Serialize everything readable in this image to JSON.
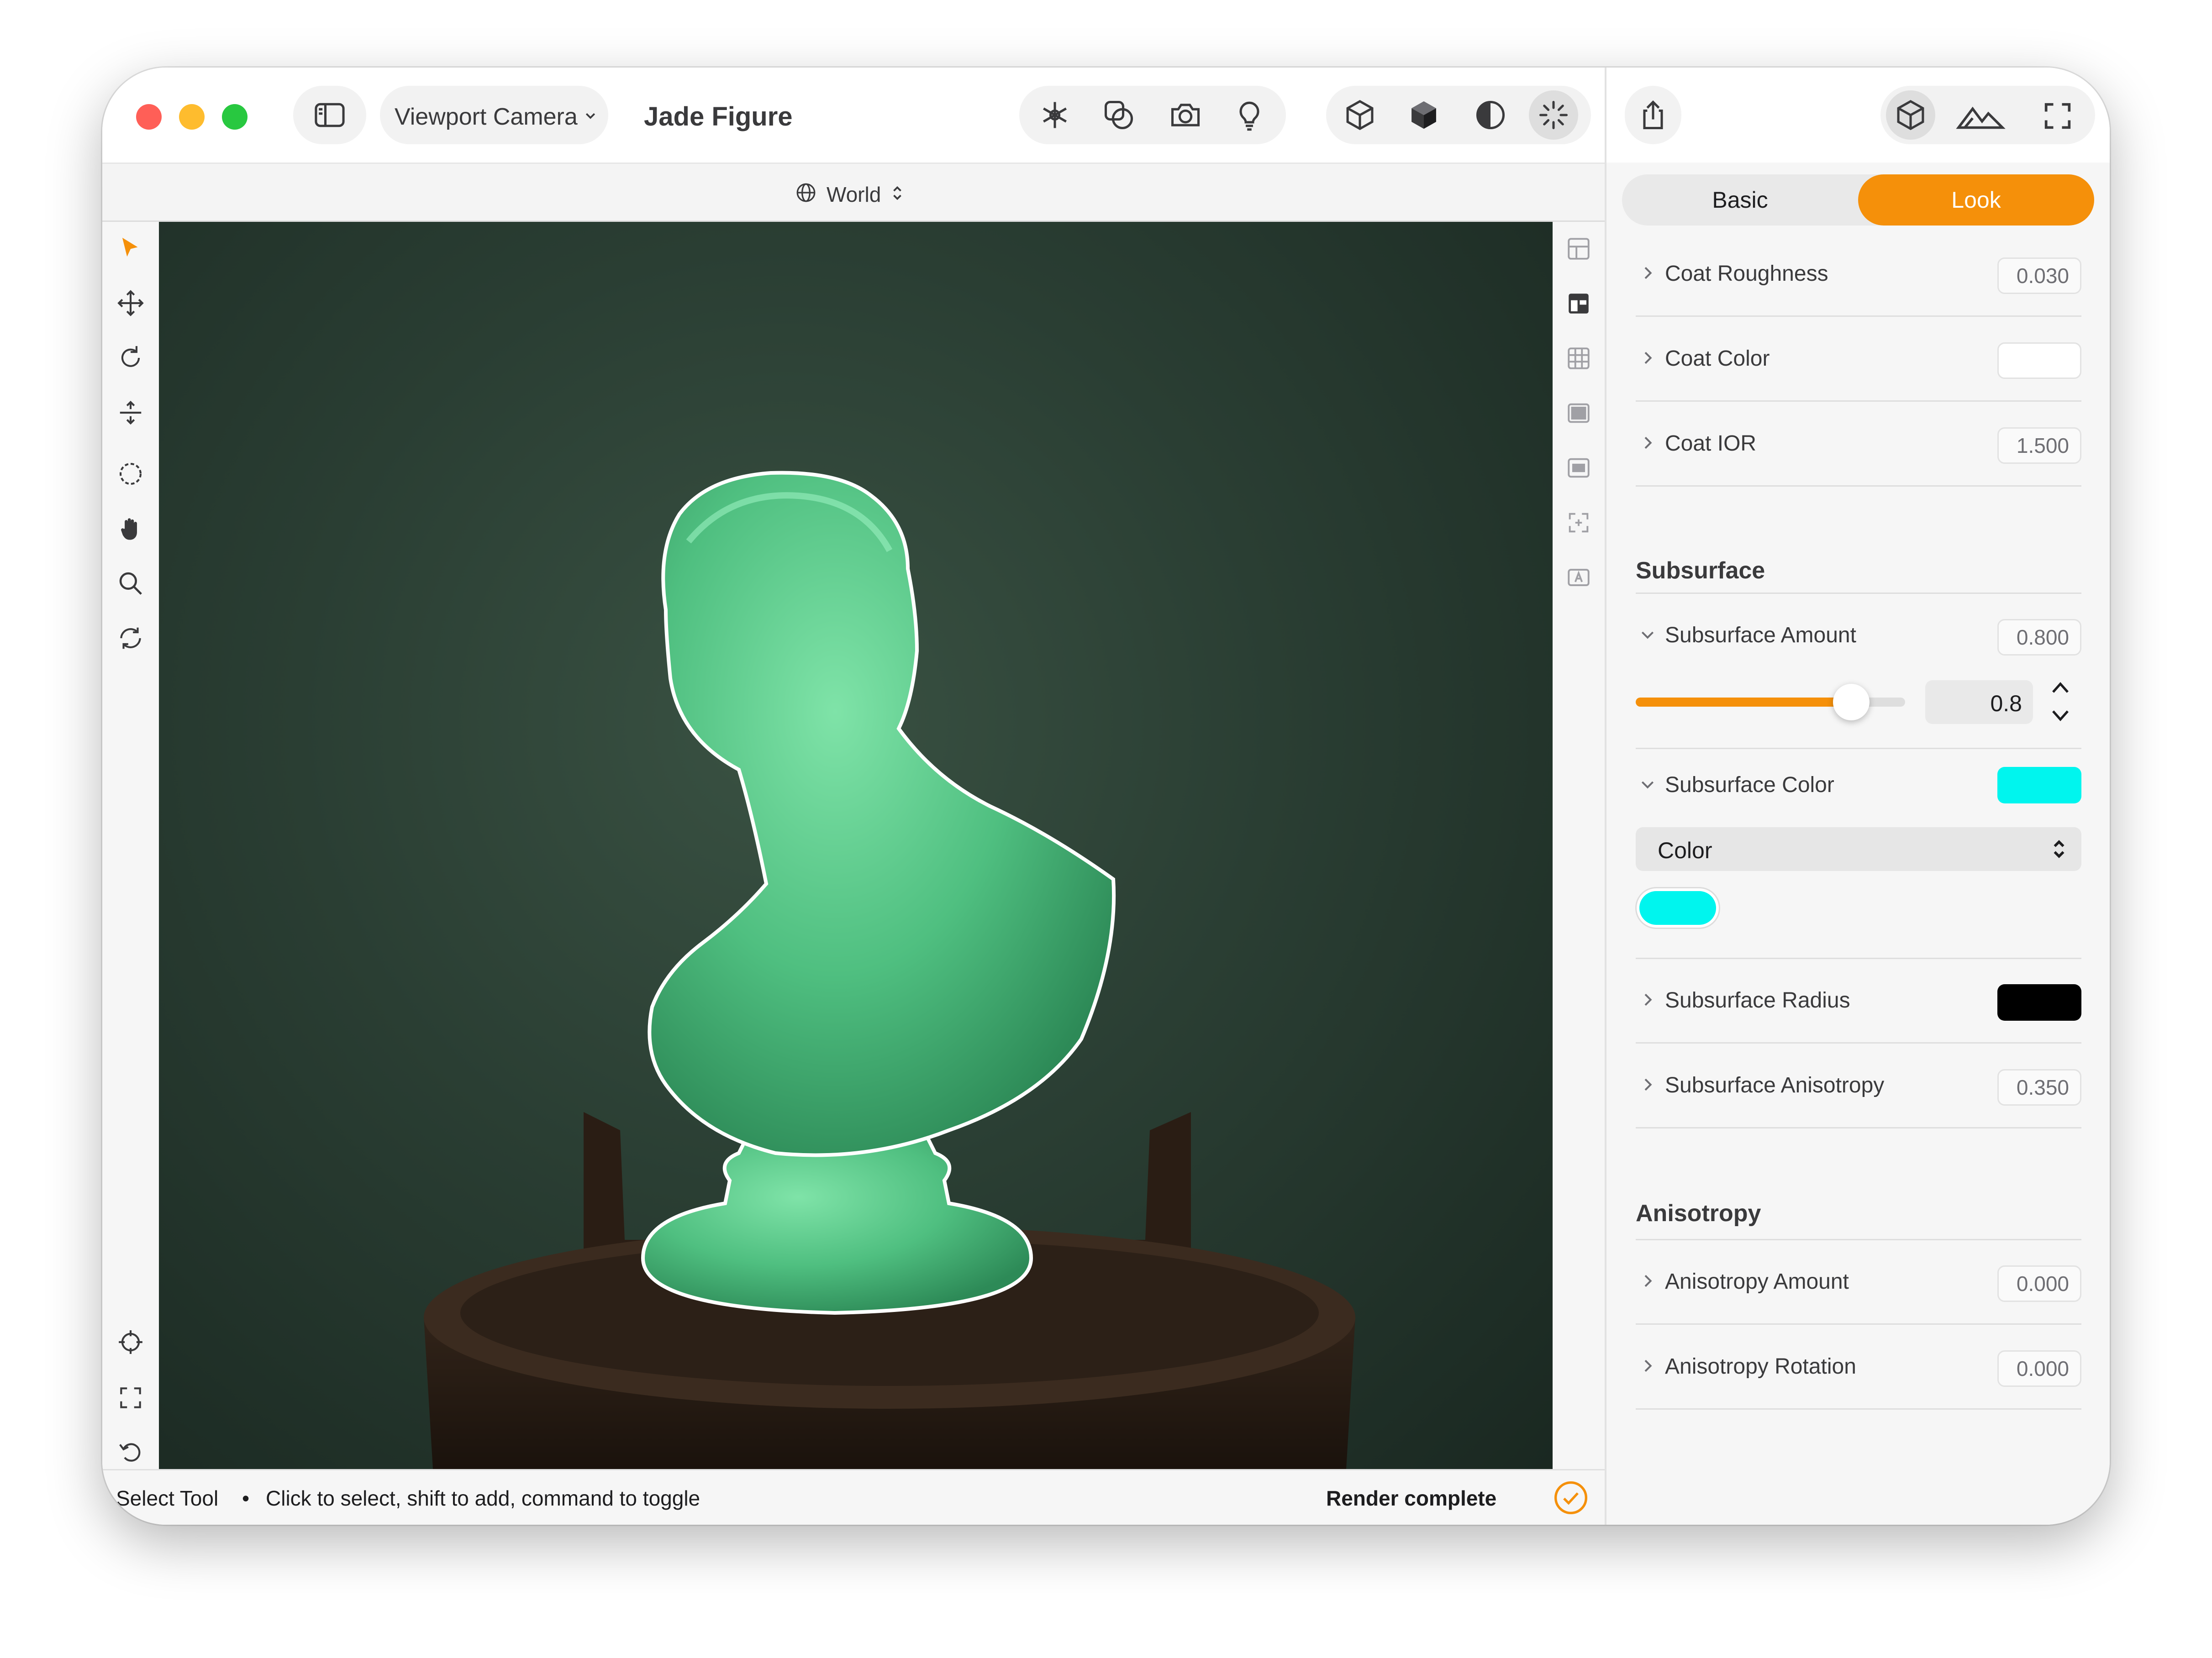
{
  "window": {
    "title": "Jade Figure",
    "camera_label": "Viewport Camera",
    "space_label": "World"
  },
  "colors": {
    "accent": "#f5900a",
    "close": "#ff5f57",
    "minimize": "#febc2e",
    "zoom": "#28c840",
    "subsurface_color": "#00f5ee",
    "radius_color": "#000000",
    "coat_color": "#ffffff"
  },
  "toolbar_icons": [
    "sidebar-icon",
    "asterisk-icon",
    "shapes-icon",
    "camera-icon",
    "lightbulb-icon",
    "wireframe-cube-icon",
    "solid-cube-icon",
    "half-circle-icon",
    "sparkle-icon",
    "share-icon",
    "cube-icon",
    "mountains-icon",
    "fullscreen-icon"
  ],
  "inspector": {
    "tabs": {
      "basic": "Basic",
      "look": "Look",
      "active": "look"
    },
    "coat": [
      {
        "label": "Coat Roughness",
        "value": "0.030"
      },
      {
        "label": "Coat Color",
        "value": ""
      },
      {
        "label": "Coat IOR",
        "value": "1.500"
      }
    ],
    "subsurface": {
      "title": "Subsurface",
      "amount_label": "Subsurface Amount",
      "amount_value": "0.800",
      "slider_value": 0.8,
      "slider_text": "0.8",
      "color_label": "Subsurface Color",
      "color_mode": "Color",
      "radius_label": "Subsurface Radius",
      "anisotropy_label": "Subsurface Anisotropy",
      "anisotropy_value": "0.350"
    },
    "anisotropy": {
      "title": "Anisotropy",
      "amount_label": "Anisotropy Amount",
      "amount_value": "0.000",
      "rotation_label": "Anisotropy Rotation",
      "rotation_value": "0.000"
    }
  },
  "status": {
    "tool": "Select Tool",
    "separator": "•",
    "hint": "Click to select, shift to add, command to toggle",
    "render": "Render complete"
  }
}
